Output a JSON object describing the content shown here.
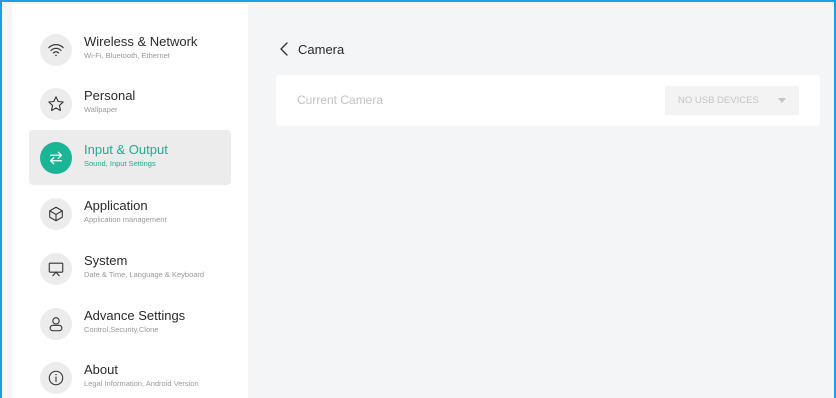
{
  "sidebar": {
    "items": [
      {
        "title": "Wireless & Network",
        "subtitle": "Wi-Fi, Bluetooth, Ethernet",
        "icon": "wifi-icon"
      },
      {
        "title": "Personal",
        "subtitle": "Wallpaper",
        "icon": "star-icon"
      },
      {
        "title": "Input & Output",
        "subtitle": "Sound, Input Settings",
        "icon": "swap-arrows-icon",
        "active": true
      },
      {
        "title": "Application",
        "subtitle": "Application management",
        "icon": "cube-icon"
      },
      {
        "title": "System",
        "subtitle": "Date & Time, Language & Keyboard",
        "icon": "presentation-board-icon"
      },
      {
        "title": "Advance Settings",
        "subtitle": "Control,Security,Clone",
        "icon": "person-icon"
      },
      {
        "title": "About",
        "subtitle": "Legal Information, Android Version",
        "icon": "info-icon"
      }
    ]
  },
  "main": {
    "title": "Camera",
    "current_camera_label": "Current Camera",
    "camera_select_value": "NO USB DEVICES"
  },
  "colors": {
    "accent": "#16b091",
    "frame_border": "#1a9ee8",
    "background": "#f4f5f6"
  }
}
